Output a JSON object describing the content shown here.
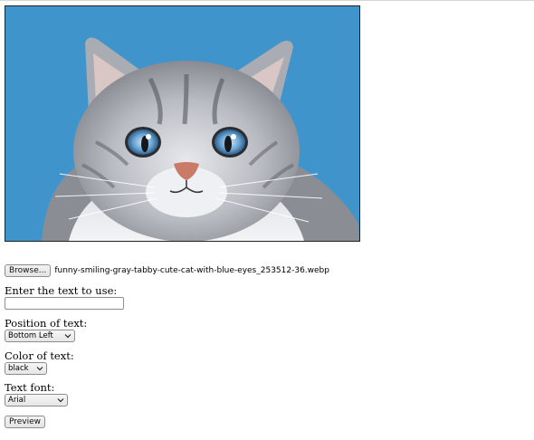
{
  "image": {
    "alt": "funny smiling gray tabby cute cat with blue eyes",
    "background_color": "#3f95cb"
  },
  "file_input": {
    "button_label": "Browse...",
    "file_name": "funny-smiling-gray-tabby-cute-cat-with-blue-eyes_253512-36.webp"
  },
  "text_field": {
    "label": "Enter the text to use:",
    "value": "",
    "placeholder": ""
  },
  "position": {
    "label": "Position of text:",
    "selected": "Bottom Left"
  },
  "color": {
    "label": "Color of text:",
    "selected": "black"
  },
  "font": {
    "label": "Text font:",
    "selected": "Arial"
  },
  "preview_button": {
    "label": "Preview"
  }
}
